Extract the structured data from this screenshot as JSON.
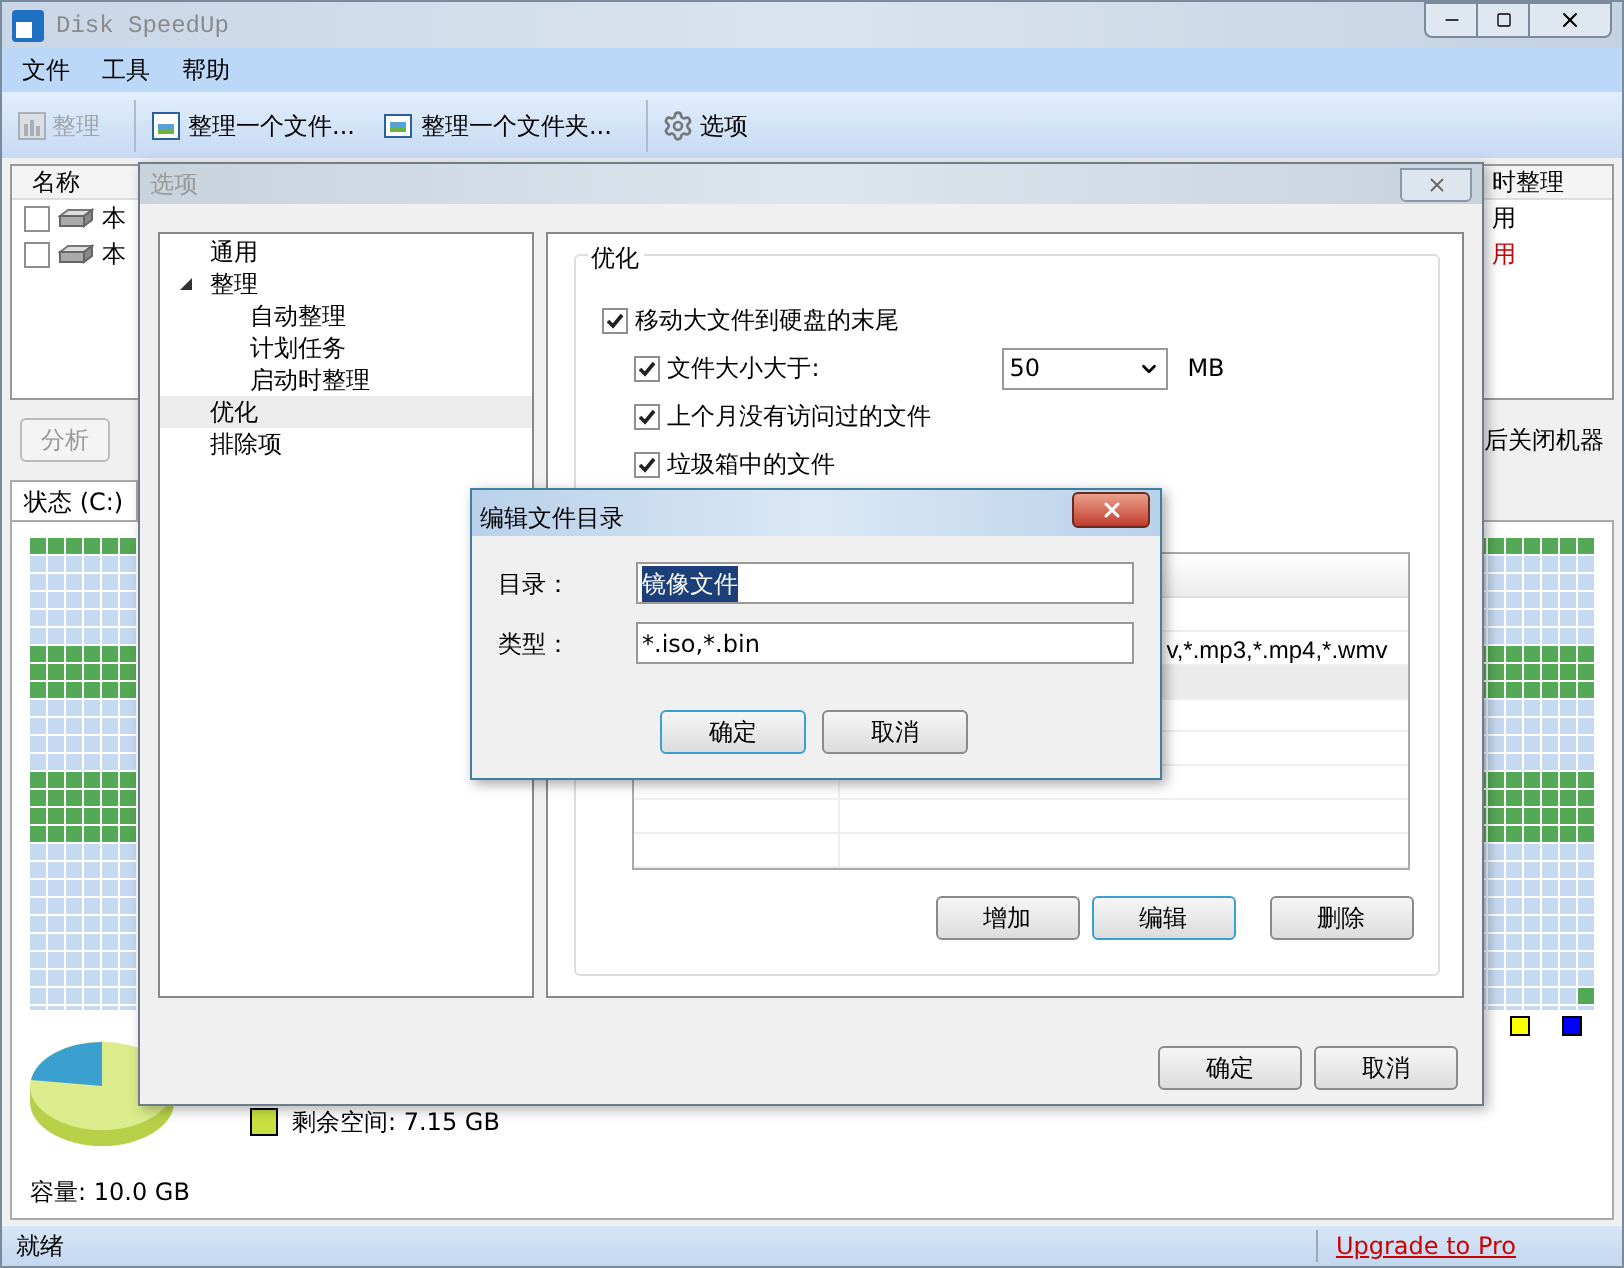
{
  "window": {
    "title": "Disk SpeedUp"
  },
  "menu": [
    "文件",
    "工具",
    "帮助"
  ],
  "toolbar": [
    {
      "kind": "defrag",
      "label": "整理",
      "disabled": true
    },
    {
      "kind": "file",
      "label": "整理一个文件...",
      "disabled": false
    },
    {
      "kind": "folder",
      "label": "整理一个文件夹...",
      "disabled": false
    },
    {
      "kind": "options",
      "label": "选项",
      "disabled": false
    }
  ],
  "drive_list": {
    "columns": [
      "名称",
      "时整理"
    ],
    "rows": [
      {
        "checked": false,
        "name": "本",
        "status": "用",
        "color": "#000000"
      },
      {
        "checked": false,
        "name": "本",
        "status": "用",
        "color": "#cc0000"
      }
    ]
  },
  "analyze_button": "分析",
  "shutdown_label": "后关闭机器",
  "tab": "状态 (C:)",
  "legend": [
    {
      "label": "剩余空间: 7.15 GB",
      "color": "#c8e040"
    }
  ],
  "legend_swatches": [
    {
      "color": "#ffff00"
    },
    {
      "color": "#0000ff"
    }
  ],
  "capacity": "容量: 10.0 GB",
  "status_bar": {
    "text": "就绪",
    "link": "Upgrade to Pro"
  },
  "options_dialog": {
    "title": "选项",
    "tree": [
      {
        "label": "通用",
        "selected": false
      },
      {
        "label": "整理",
        "selected": false,
        "expanded": true,
        "children": [
          {
            "label": "自动整理",
            "selected": false
          },
          {
            "label": "计划任务",
            "selected": false
          },
          {
            "label": "启动时整理",
            "selected": false
          }
        ]
      },
      {
        "label": "优化",
        "selected": true
      },
      {
        "label": "排除项",
        "selected": false
      }
    ],
    "group_title": "优化",
    "options": [
      {
        "kind": "checkbox",
        "label": "移动大文件到硬盘的末尾",
        "checked": true,
        "children": [
          {
            "kind": "dropdown",
            "label": "文件大小大于:",
            "checked": true,
            "value": "50",
            "unit": "MB"
          },
          {
            "kind": "checkbox",
            "label": "上个月没有访问过的文件",
            "checked": true
          },
          {
            "kind": "checkbox",
            "label": "垃圾箱中的文件",
            "checked": true
          }
        ]
      }
    ],
    "table_rows": [
      {
        "selected": false
      },
      {
        "column_2": "v,*.mp3,*.mp4,*.wmv",
        "selected": false
      },
      {
        "selected": true
      }
    ],
    "table_buttons": [
      {
        "label": "增加",
        "focused": false
      },
      {
        "label": "编辑",
        "focused": true
      },
      {
        "label": "删除",
        "focused": false
      }
    ],
    "buttons": [
      "确定",
      "取消"
    ]
  },
  "edit_dialog": {
    "title": "编辑文件目录",
    "fields": [
      {
        "label": "目录：",
        "value": "镜像文件",
        "selected": true
      },
      {
        "label": "类型：",
        "value": "*.iso,*.bin",
        "selected": false
      }
    ],
    "buttons": [
      {
        "label": "确定",
        "focused": true
      },
      {
        "label": "取消",
        "focused": false
      }
    ]
  }
}
